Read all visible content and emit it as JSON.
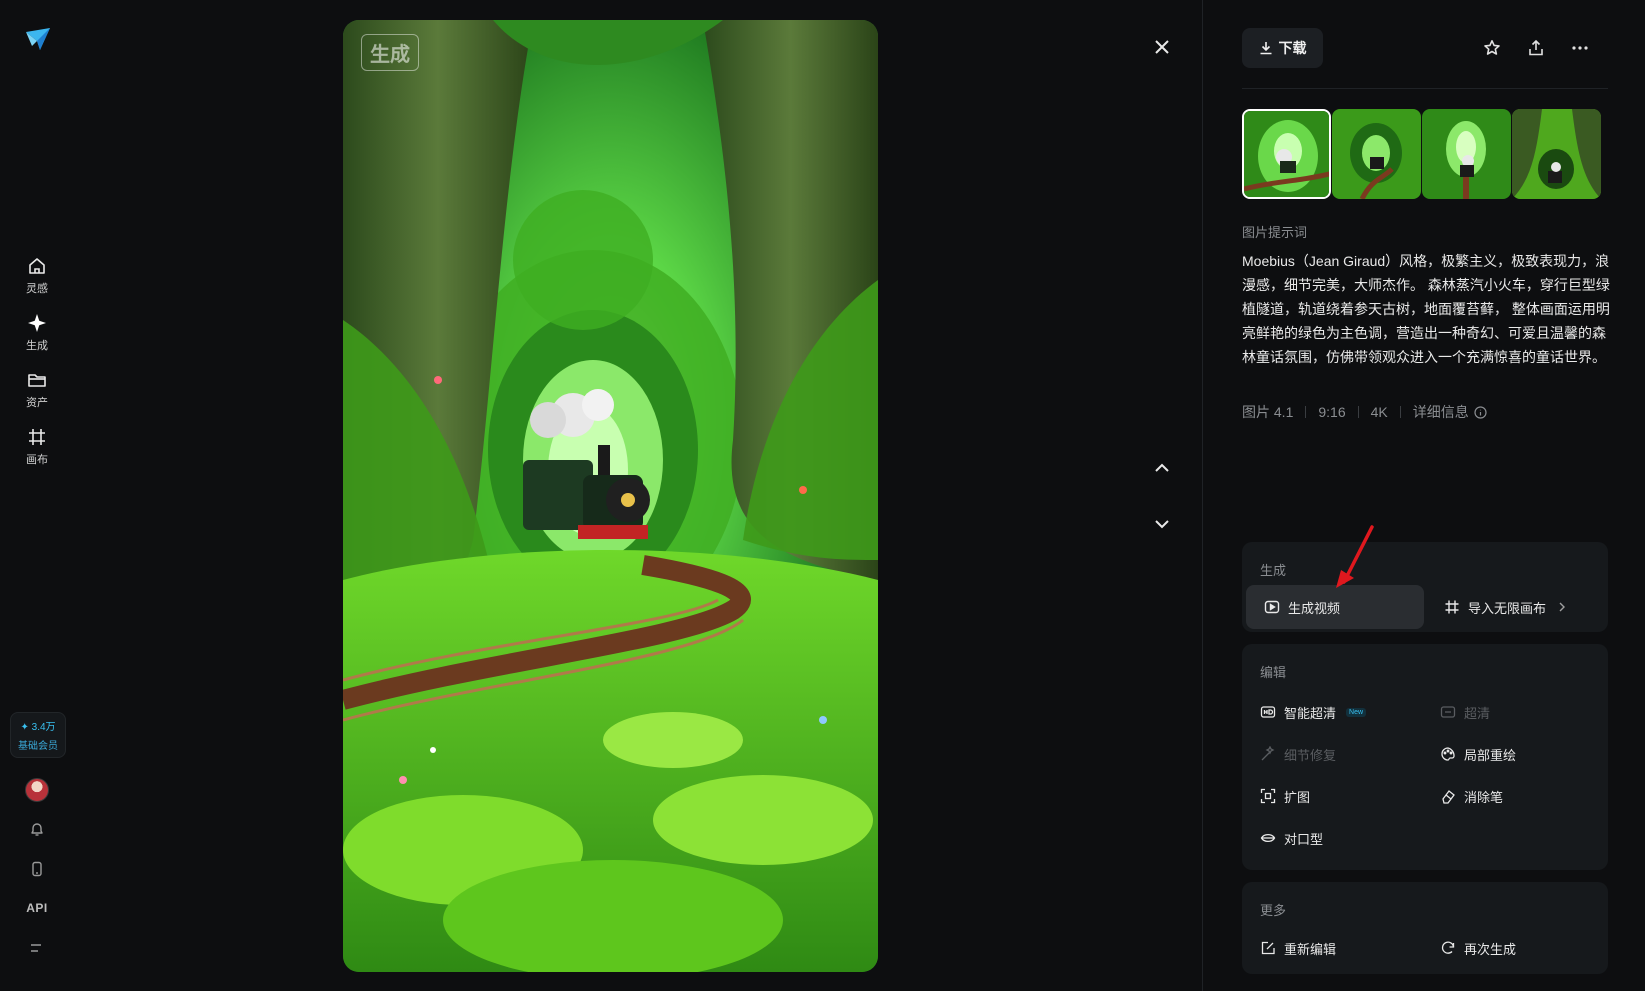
{
  "sidebar": {
    "items": [
      {
        "label": "灵感",
        "icon": "home-icon"
      },
      {
        "label": "生成",
        "icon": "sparkle-icon"
      },
      {
        "label": "资产",
        "icon": "folder-icon"
      },
      {
        "label": "画布",
        "icon": "canvas-grid-icon"
      }
    ],
    "credits": {
      "amount": "✦ 3.4万",
      "membership": "基础会员"
    },
    "bottom": {
      "api_label": "API"
    }
  },
  "viewer": {
    "watermark": "生成",
    "colors": {
      "sky": "#35d35a",
      "moss": "#4fcf1a",
      "trunk": "#3f5a2a"
    }
  },
  "toolbar": {
    "download_label": "下载"
  },
  "prompt": {
    "label": "图片提示词",
    "text": "Moebius（Jean Giraud）风格，极繁主义，极致表现力，浪漫感，细节完美，大师杰作。 森林蒸汽小火车，穿行巨型绿植隧道，轨道绕着参天古树，地面覆苔藓， 整体画面运用明亮鲜艳的绿色为主色调，营造出一种奇幻、可爱且温馨的森林童话氛围，仿佛带领观众进入一个充满惊喜的童话世界。",
    "meta": {
      "model": "图片 4.1",
      "ratio": "9:16",
      "resolution": "4K",
      "details_label": "详细信息"
    }
  },
  "generate_card": {
    "title": "生成",
    "actions": [
      {
        "label": "生成视频",
        "icon": "play-box-icon"
      },
      {
        "label": "导入无限画布",
        "icon": "canvas-grid-icon"
      }
    ]
  },
  "edit_card": {
    "title": "编辑",
    "actions": [
      {
        "label": "智能超清",
        "badge": "New"
      },
      {
        "label": "超清"
      },
      {
        "label": "细节修复"
      },
      {
        "label": "局部重绘"
      },
      {
        "label": "扩图"
      },
      {
        "label": "消除笔"
      },
      {
        "label": "对口型"
      }
    ]
  },
  "more_card": {
    "title": "更多",
    "actions": [
      {
        "label": "重新编辑"
      },
      {
        "label": "再次生成"
      }
    ]
  },
  "accent_color": "#39c0f0"
}
